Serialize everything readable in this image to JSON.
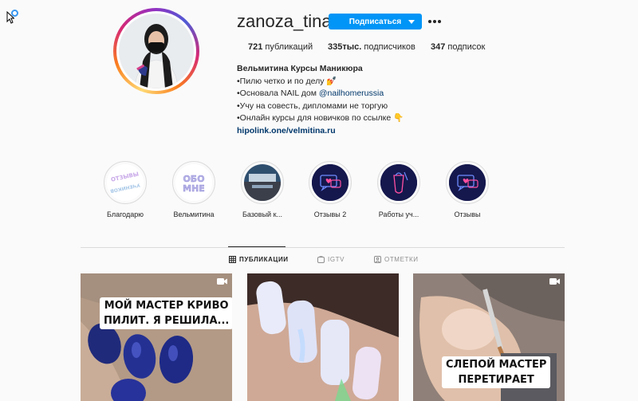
{
  "profile": {
    "username": "zanoza_tina",
    "follow_label": "Подписаться",
    "stats": {
      "posts_count": "721",
      "posts_label": "публикаций",
      "followers_count": "335тыс.",
      "followers_label": "подписчиков",
      "following_count": "347",
      "following_label": "подписок"
    },
    "bio": {
      "name": "Вельмитина Курсы Маникюра",
      "line1": "•Пилю четко и по делу 💅",
      "line2_prefix": "•Основала NAIL дом ",
      "line2_mention": "@nailhomerussia",
      "line3": "•Учу на совесть, дипломами не торгую",
      "line4": "•Онлайн курсы для новичков по ссылке 👇",
      "link": "hipolink.one/velmitina.ru"
    }
  },
  "highlights": [
    {
      "label": "Благодарю",
      "art_text": "ОТЗЫВЫ УЧЕНИКОВ"
    },
    {
      "label": "Вельмитина",
      "art_text": "ОБО МНЕ"
    },
    {
      "label": "Базовый к...",
      "art_text": ""
    },
    {
      "label": "Отзывы 2",
      "art_text": ""
    },
    {
      "label": "Работы уч...",
      "art_text": ""
    },
    {
      "label": "Отзывы",
      "art_text": ""
    }
  ],
  "tabs": [
    {
      "label": "ПУБЛИКАЦИИ",
      "icon": "grid-icon",
      "active": true
    },
    {
      "label": "IGTV",
      "icon": "igtv-icon",
      "active": false
    },
    {
      "label": "ОТМЕТКИ",
      "icon": "tag-icon",
      "active": false
    }
  ],
  "posts": [
    {
      "caption_line1": "МОЙ МАСТЕР КРИВО",
      "caption_line2": "ПИЛИТ. Я РЕШИЛА...",
      "type": "video"
    },
    {
      "caption_line1": "",
      "caption_line2": "",
      "type": "image"
    },
    {
      "caption_line1": "СЛЕПОЙ МАСТЕР",
      "caption_line2": "ПЕРЕТИРАЕТ",
      "type": "video"
    }
  ],
  "colors": {
    "accent": "#0095f6",
    "link": "#00376b",
    "border": "#dbdbdb",
    "background": "#fafafa"
  }
}
